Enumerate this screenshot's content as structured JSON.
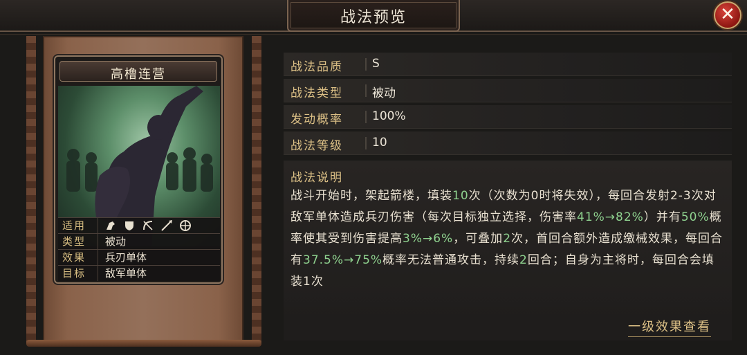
{
  "header": {
    "title": "战法预览",
    "close_icon": "close-icon"
  },
  "card": {
    "name": "高橹连营",
    "art_icon": "archer-silhouette-art",
    "stats": {
      "applicable_label": "适用",
      "applicable_icons": [
        "cavalry-icon",
        "shield-icon",
        "bow-icon",
        "spear-icon",
        "siege-icon"
      ],
      "type_label": "类型",
      "type_value": "被动",
      "effect_label": "效果",
      "effect_value": "兵刃单体",
      "target_label": "目标",
      "target_value": "敌军单体"
    }
  },
  "info": {
    "quality_label": "战法品质",
    "quality_value": "S",
    "type_label": "战法类型",
    "type_value": "被动",
    "chance_label": "发动概率",
    "chance_value": "100%",
    "level_label": "战法等级",
    "level_value": "10"
  },
  "description": {
    "heading": "战法说明",
    "segments": [
      {
        "t": "战斗开始时，架起箭楼，填装",
        "g": false
      },
      {
        "t": "10",
        "g": true
      },
      {
        "t": "次（次数为0时将失效），每回合发射2-3次对敌军单体造成兵刃伤害（每次目标独立选择，伤害率",
        "g": false
      },
      {
        "t": "41%→82%",
        "g": true
      },
      {
        "t": "）并有",
        "g": false
      },
      {
        "t": "50%",
        "g": true
      },
      {
        "t": "概率使其受到伤害提高",
        "g": false
      },
      {
        "t": "3%→6%",
        "g": true
      },
      {
        "t": "，可叠加",
        "g": false
      },
      {
        "t": "2",
        "g": true
      },
      {
        "t": "次，首回合额外造成缴械效果，每回合有",
        "g": false
      },
      {
        "t": "37.5%→75%",
        "g": true
      },
      {
        "t": "概率无法普通攻击，持续",
        "g": false
      },
      {
        "t": "2",
        "g": true
      },
      {
        "t": "回合；自身为主将时，每回合会填装1次",
        "g": false
      }
    ]
  },
  "more_link": "一级效果查看",
  "colors": {
    "accent_gold": "#dcc086",
    "highlight_green": "#8fd28f",
    "close_red": "#b5261e"
  }
}
